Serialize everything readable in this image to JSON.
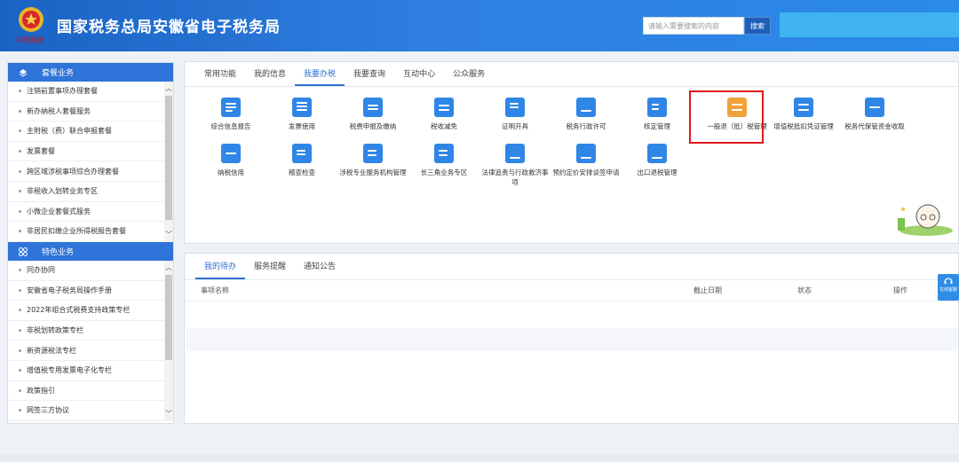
{
  "header": {
    "title": "国家税务总局安徽省电子税务局",
    "search_placeholder": "请输入需要搜索的内容",
    "search_button": "搜索"
  },
  "sidebar": {
    "package_section": {
      "title": "套餐业务",
      "items": [
        "注销前置事项办理套餐",
        "新办纳税人套餐服务",
        "主附税（费）联合申报套餐",
        "发票套餐",
        "跨区域涉税事项综合办理套餐",
        "非税收入划转业务专区",
        "小微企业套餐式服务",
        "非居民扣缴企业所得税报告套餐"
      ]
    },
    "feature_section": {
      "title": "特色业务",
      "items": [
        "同办协同",
        "安徽省电子税务局操作手册",
        "2022年组合式税费支持政策专栏",
        "非税划转政策专栏",
        "新资源税法专栏",
        "增值税专用发票电子化专栏",
        "政策指引",
        "网签三方协议"
      ]
    }
  },
  "main": {
    "tabs": [
      "常用功能",
      "我的信息",
      "我要办税",
      "我要查询",
      "互动中心",
      "公众服务"
    ],
    "active_tab": "我要办税",
    "services": [
      {
        "label": "综合信息报告",
        "icon": "report-icon"
      },
      {
        "label": "发票使用",
        "icon": "invoice-icon"
      },
      {
        "label": "税费申报及缴纳",
        "icon": "tax-filing-icon"
      },
      {
        "label": "税收减免",
        "icon": "tax-relief-icon"
      },
      {
        "label": "证明开具",
        "icon": "certificate-icon"
      },
      {
        "label": "税务行政许可",
        "icon": "license-icon"
      },
      {
        "label": "核定管理",
        "icon": "assessment-icon"
      },
      {
        "label": "一般退（抵）税管理",
        "icon": "refund-icon"
      },
      {
        "label": "增值税抵扣凭证管理",
        "icon": "deduction-icon"
      },
      {
        "label": "税务代保管资金收取",
        "icon": "custody-icon"
      },
      {
        "label": "纳税信用",
        "icon": "credit-icon"
      },
      {
        "label": "稽查检查",
        "icon": "inspection-icon"
      },
      {
        "label": "涉税专业服务机构管理",
        "icon": "agency-icon"
      },
      {
        "label": "长三角业务专区",
        "icon": "yangtze-icon"
      },
      {
        "label": "法律追责与行政救济事项",
        "icon": "legal-icon"
      },
      {
        "label": "预约定价安排谈签申请",
        "icon": "pricing-icon"
      },
      {
        "label": "出口退税管理",
        "icon": "export-refund-icon"
      }
    ]
  },
  "todo": {
    "tabs": [
      "我的待办",
      "服务提醒",
      "通知公告"
    ],
    "active_tab": "我的待办",
    "columns": [
      "事项名称",
      "截止日期",
      "状态",
      "操作"
    ]
  },
  "online_service": "在线客服",
  "colors": {
    "header_blue": "#2a7ad9",
    "accent": "#2d6fd0",
    "highlight_red": "#e0191e"
  }
}
